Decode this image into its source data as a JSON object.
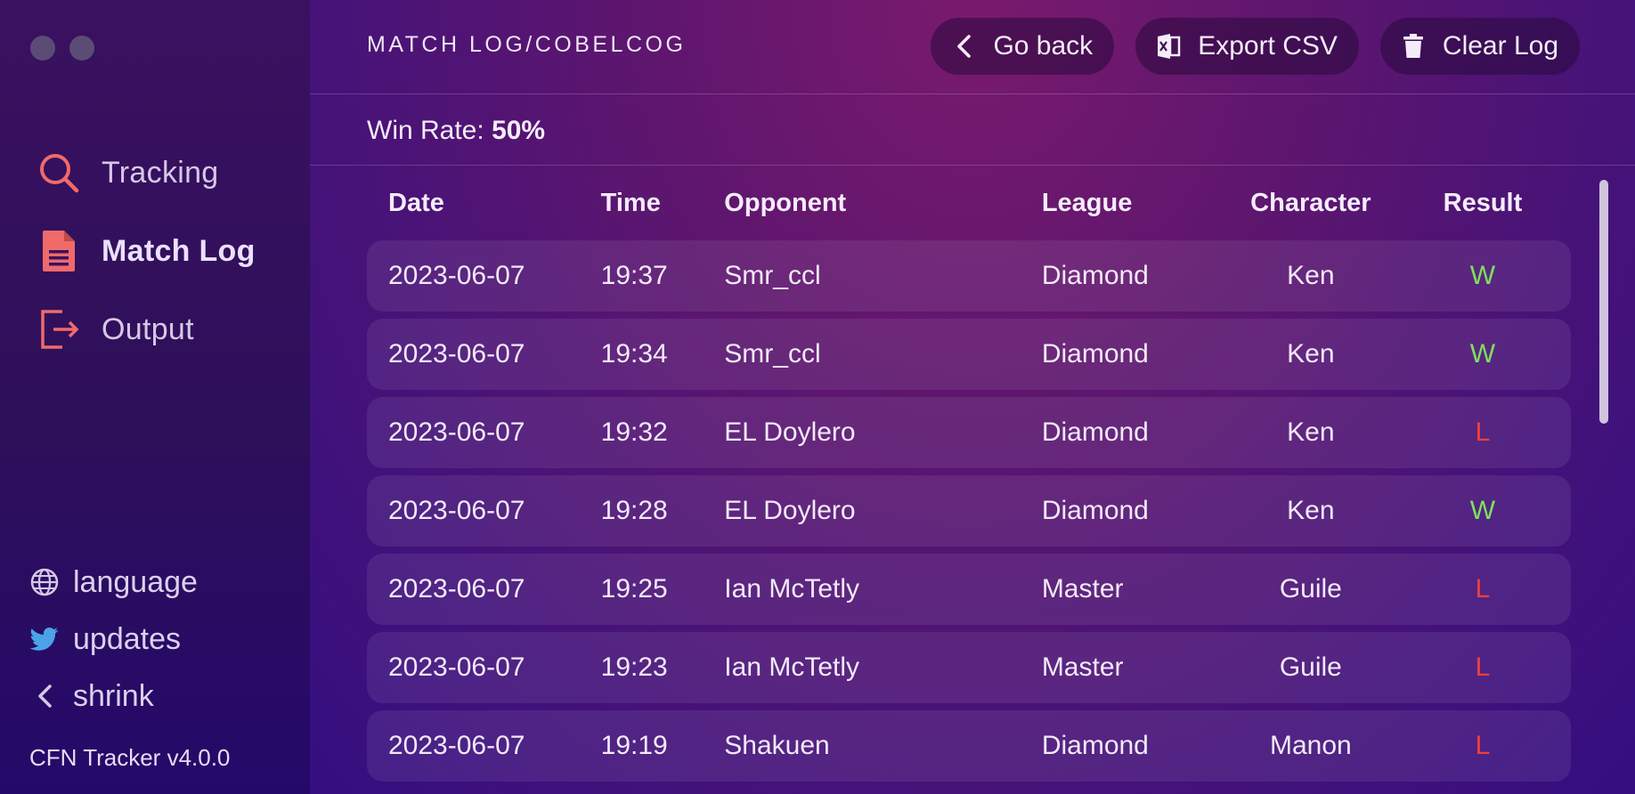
{
  "window": {
    "traffic_lights": 2
  },
  "sidebar": {
    "nav": [
      {
        "label": "Tracking",
        "icon": "search-icon",
        "active": false
      },
      {
        "label": "Match Log",
        "icon": "document-icon",
        "active": true
      },
      {
        "label": "Output",
        "icon": "export-icon",
        "active": false
      }
    ],
    "links": [
      {
        "label": "language",
        "icon": "globe-icon"
      },
      {
        "label": "updates",
        "icon": "twitter-icon"
      },
      {
        "label": "shrink",
        "icon": "chevron-left-icon"
      }
    ],
    "version": "CFN Tracker v4.0.0"
  },
  "header": {
    "breadcrumb": "MATCH LOG/COBELCOG",
    "buttons": {
      "go_back": "Go back",
      "export_csv": "Export CSV",
      "clear_log": "Clear Log"
    }
  },
  "stats": {
    "win_rate_label": "Win Rate:",
    "win_rate_value": "50%"
  },
  "table": {
    "columns": [
      "Date",
      "Time",
      "Opponent",
      "League",
      "Character",
      "Result"
    ],
    "rows": [
      {
        "date": "2023-06-07",
        "time": "19:37",
        "opponent": "Smr_ccl",
        "league": "Diamond",
        "character": "Ken",
        "result": "W"
      },
      {
        "date": "2023-06-07",
        "time": "19:34",
        "opponent": "Smr_ccl",
        "league": "Diamond",
        "character": "Ken",
        "result": "W"
      },
      {
        "date": "2023-06-07",
        "time": "19:32",
        "opponent": "EL Doylero",
        "league": "Diamond",
        "character": "Ken",
        "result": "L"
      },
      {
        "date": "2023-06-07",
        "time": "19:28",
        "opponent": "EL Doylero",
        "league": "Diamond",
        "character": "Ken",
        "result": "W"
      },
      {
        "date": "2023-06-07",
        "time": "19:25",
        "opponent": "Ian McTetly",
        "league": "Master",
        "character": "Guile",
        "result": "L"
      },
      {
        "date": "2023-06-07",
        "time": "19:23",
        "opponent": "Ian McTetly",
        "league": "Master",
        "character": "Guile",
        "result": "L"
      },
      {
        "date": "2023-06-07",
        "time": "19:19",
        "opponent": "Shakuen",
        "league": "Diamond",
        "character": "Manon",
        "result": "L"
      }
    ]
  },
  "colors": {
    "accent": "#f06a6a",
    "win": "#7ee05e",
    "loss": "#f0403a"
  }
}
